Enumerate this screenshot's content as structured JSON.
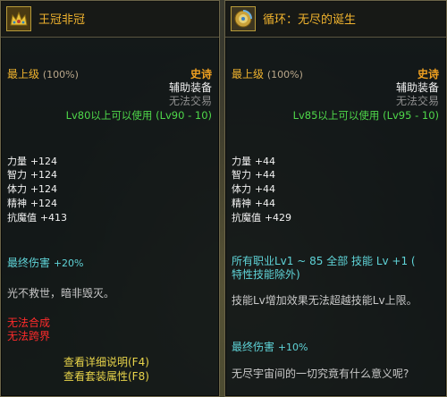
{
  "left": {
    "name": "王冠非冠",
    "grade": "最上级",
    "grade_pct": "(100%)",
    "rarity": "史诗",
    "type": "辅助装备",
    "trade": "无法交易",
    "level_req": "Lv80以上可以使用 (Lv90 - 10)",
    "stats": [
      {
        "label": "力量",
        "value": "+124"
      },
      {
        "label": "智力",
        "value": "+124"
      },
      {
        "label": "体力",
        "value": "+124"
      },
      {
        "label": "精神",
        "value": "+124"
      },
      {
        "label": "抗魔值",
        "value": "+413"
      }
    ],
    "final_damage_label": "最终伤害",
    "final_damage_value": "+20%",
    "flavor": "光不救世，暗非毁灭。",
    "restrictions": [
      "无法合成",
      "无法跨界"
    ],
    "links": [
      "查看详细说明(F4)",
      "查看套装属性(F8)"
    ]
  },
  "right": {
    "name": "循环：无尽的诞生",
    "grade": "最上级",
    "grade_pct": "(100%)",
    "rarity": "史诗",
    "type": "辅助装备",
    "trade": "无法交易",
    "level_req": "Lv85以上可以使用 (Lv95 - 10)",
    "stats": [
      {
        "label": "力量",
        "value": "+44"
      },
      {
        "label": "智力",
        "value": "+44"
      },
      {
        "label": "体力",
        "value": "+44"
      },
      {
        "label": "精神",
        "value": "+44"
      },
      {
        "label": "抗魔值",
        "value": "+429"
      }
    ],
    "skill_line1": "所有职业Lv1 ~ 85 全部 技能 Lv +1 (",
    "skill_line2": "特性技能除外)",
    "skill_note": "技能Lv增加效果无法超越技能Lv上限。",
    "final_damage_label": "最终伤害",
    "final_damage_value": "+10%",
    "flavor": "无尽宇宙间的一切究竟有什么意义呢?"
  }
}
